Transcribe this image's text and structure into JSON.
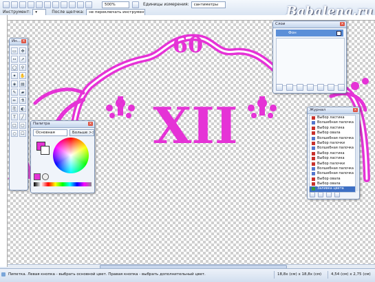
{
  "toolbar": {
    "instrument_label": "Инструмент:",
    "after_click_label": "После щелчка:",
    "after_click_value": "не переключать инструмент",
    "zoom_value": "500%",
    "units_label": "Единицы измерения:",
    "units_value": "сантиметры"
  },
  "logo": "Babalena.ru",
  "canvas": {
    "number_text": "60",
    "numeral_text": "XII",
    "art_color": "#e533d6"
  },
  "tools_window": {
    "title": "Ин..."
  },
  "palette_window": {
    "title": "Палитра",
    "mode_value": "Основная",
    "more_button": "Больше >>",
    "primary_color": "#e533d6",
    "secondary_color": "#ffffff"
  },
  "layers_window": {
    "title": "Слои",
    "layer_name": "Фон"
  },
  "history_window": {
    "title": "Журнал",
    "items": [
      {
        "label": "Выбор ластика",
        "icon": "eraser"
      },
      {
        "label": "Волшебная палочка",
        "icon": "wand"
      },
      {
        "label": "Выбор ластика",
        "icon": "eraser"
      },
      {
        "label": "Выбор овала",
        "icon": "eraser"
      },
      {
        "label": "Волшебная палочка",
        "icon": "wand"
      },
      {
        "label": "Выбор палочки",
        "icon": "eraser"
      },
      {
        "label": "Волшебная палочка",
        "icon": "wand"
      },
      {
        "label": "Выбор ластика",
        "icon": "eraser"
      },
      {
        "label": "Выбор ластика",
        "icon": "eraser"
      },
      {
        "label": "Выбор палочки",
        "icon": "eraser"
      },
      {
        "label": "Волшебная палочка",
        "icon": "wand"
      },
      {
        "label": "Волшебная палочка",
        "icon": "wand"
      },
      {
        "label": "Выбор овала",
        "icon": "eraser"
      },
      {
        "label": "Выбор овала",
        "icon": "eraser"
      },
      {
        "label": "Заливка цвета",
        "icon": "fill"
      }
    ]
  },
  "status": {
    "message": "Пипетка. Левая кнопка - выбрать основной цвет. Правая кнопка - выбрать дополнительный цвет.",
    "size": "18,8х (см) х 18,8х (см)",
    "coords": "4,54 (см) х 2,75 (см)"
  }
}
